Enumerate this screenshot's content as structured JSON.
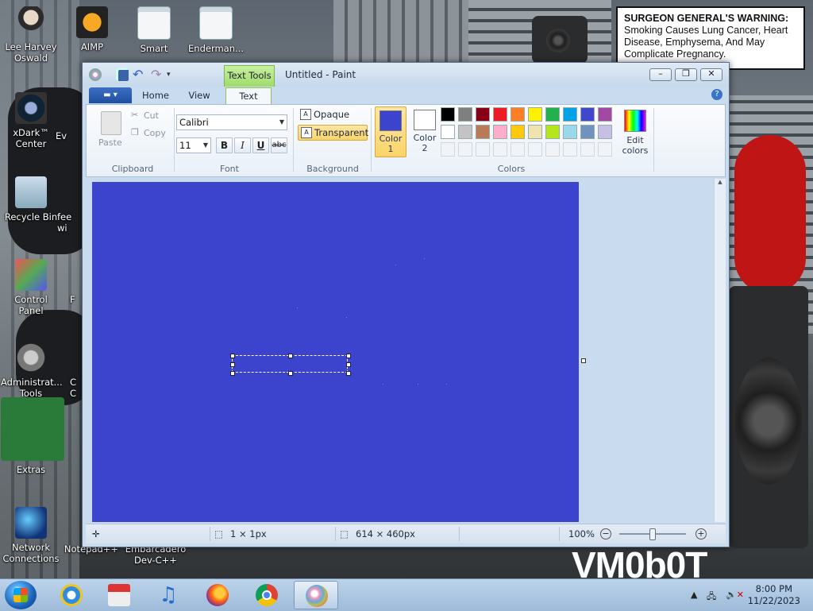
{
  "warning": {
    "heading": "SURGEON GENERAL'S WARNING:",
    "text": " Smoking Causes Lung Cancer, Heart Disease, Emphysema, And May Complicate Pregnancy."
  },
  "desktop_icons": [
    {
      "label": "Lee Harvey Oswald",
      "icon": "person-icon"
    },
    {
      "label": "AIMP",
      "icon": "aimp-icon"
    },
    {
      "label": "Smart",
      "icon": "app-icon"
    },
    {
      "label": "Enderman...",
      "icon": "app-icon"
    },
    {
      "label": "xDark™ Center",
      "icon": "xdark-icon"
    },
    {
      "label": "Ev",
      "icon": "app-icon"
    },
    {
      "label": "Recycle Bin",
      "icon": "recycle-bin-icon"
    },
    {
      "label": "fee wi",
      "icon": "app-icon"
    },
    {
      "label": "Control Panel",
      "icon": "control-panel-icon"
    },
    {
      "label": "F",
      "icon": "app-icon"
    },
    {
      "label": "Administrat... Tools",
      "icon": "admin-tools-icon"
    },
    {
      "label": "C C",
      "icon": "app-icon"
    },
    {
      "label": "Extras",
      "icon": "extras-icon"
    },
    {
      "label": "Network Connections",
      "icon": "network-icon"
    },
    {
      "label": "Notepad++",
      "icon": "app-icon"
    },
    {
      "label": "Embarcadero Dev-C++",
      "icon": "app-icon"
    }
  ],
  "wallpaper_text": "VM0b0T",
  "window": {
    "title": "Untitled - Paint",
    "context_tab": "Text Tools",
    "tabs": [
      "Home",
      "View",
      "Text"
    ],
    "active_tab": "Text",
    "help": "?"
  },
  "ribbon": {
    "clipboard": {
      "label": "Clipboard",
      "paste": "Paste",
      "cut": "Cut",
      "copy": "Copy"
    },
    "font": {
      "label": "Font",
      "family": "Calibri",
      "size": "11",
      "bold": "B",
      "italic": "I",
      "underline": "U",
      "strike": "abc"
    },
    "background": {
      "label": "Background",
      "opaque": "Opaque",
      "transparent": "Transparent",
      "selected": "Transparent"
    },
    "colors": {
      "label": "Colors",
      "color1_label_a": "Color",
      "color1_label_b": "1",
      "color2_label_a": "Color",
      "color2_label_b": "2",
      "color1": "#3c43cd",
      "color2": "#ffffff",
      "edit_a": "Edit",
      "edit_b": "colors",
      "palette_row1": [
        "#000000",
        "#7f7f7f",
        "#880015",
        "#ed1c24",
        "#ff7f27",
        "#fff200",
        "#22b14c",
        "#00a2e8",
        "#3f48cc",
        "#a349a4"
      ],
      "palette_row2": [
        "#ffffff",
        "#c3c3c3",
        "#b97a57",
        "#ffaec9",
        "#ffc90e",
        "#efe4b0",
        "#b5e61d",
        "#99d9ea",
        "#7092be",
        "#c8bfe7"
      ]
    }
  },
  "canvas": {
    "color": "#3c43cd"
  },
  "status": {
    "selection_size": "1 × 1px",
    "image_size": "614 × 460px",
    "zoom": "100%",
    "zoom_level": 1.0
  },
  "taskbar": {
    "apps": [
      "internet-explorer-icon",
      "store-icon",
      "music-icon",
      "firefox-icon",
      "chrome-icon",
      "paint-icon"
    ],
    "active": "paint-icon",
    "time": "8:00 PM",
    "date": "11/22/2023"
  }
}
